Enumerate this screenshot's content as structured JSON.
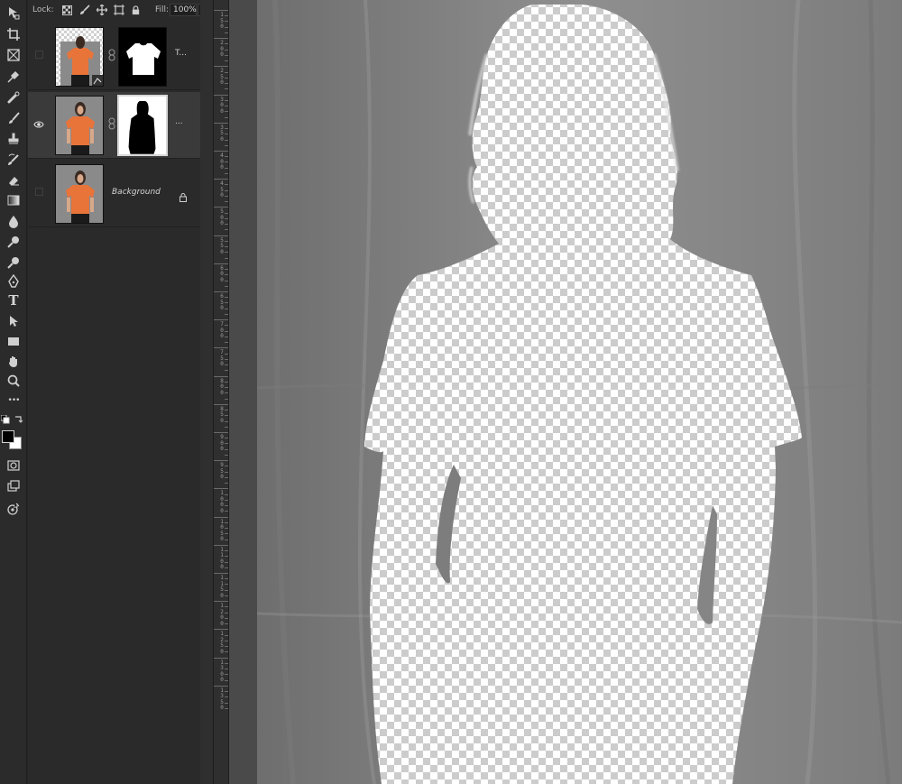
{
  "colors": {
    "panel_bg": "#2a2a2a",
    "selected_layer_bg": "#3a3a3a",
    "backdrop_gray": "#8a8a8a",
    "shirt_orange": "#e8743a",
    "pasteboard": "#4a4a4a"
  },
  "toolbar": {
    "tools": [
      {
        "name": "move-tool",
        "icon": "move-icon"
      },
      {
        "name": "crop-tool",
        "icon": "crop-icon"
      },
      {
        "name": "frame-tool",
        "icon": "frame-icon"
      },
      {
        "name": "eyedropper-tool",
        "icon": "eyedropper-icon"
      },
      {
        "name": "spot-healing-tool",
        "icon": "healing-brush-icon"
      },
      {
        "name": "brush-tool",
        "icon": "brush-icon"
      },
      {
        "name": "clone-stamp-tool",
        "icon": "stamp-icon"
      },
      {
        "name": "history-brush-tool",
        "icon": "history-brush-icon"
      },
      {
        "name": "eraser-tool",
        "icon": "eraser-icon"
      },
      {
        "name": "gradient-tool",
        "icon": "gradient-icon"
      },
      {
        "name": "blur-tool",
        "icon": "drop-icon"
      },
      {
        "name": "dodge-tool",
        "icon": "dodge-icon"
      },
      {
        "name": "pen-tool",
        "icon": "pen-icon"
      },
      {
        "name": "type-tool",
        "icon": "type-icon"
      },
      {
        "name": "path-selection-tool",
        "icon": "arrow-pointer-icon"
      },
      {
        "name": "rectangle-tool",
        "icon": "rectangle-icon"
      },
      {
        "name": "hand-tool",
        "icon": "hand-icon"
      },
      {
        "name": "zoom-tool",
        "icon": "magnifier-icon"
      },
      {
        "name": "edit-toolbar",
        "icon": "more-dots-icon"
      }
    ],
    "type_glyph": "T",
    "more_glyph": "•••"
  },
  "lockbar": {
    "lock_label": "Lock:",
    "fill_label": "Fill:",
    "fill_value": "100%"
  },
  "layers": [
    {
      "name": "T...",
      "visible": false,
      "has_mask": true,
      "mask": "shirt",
      "selected": false,
      "italic": false,
      "locked": false
    },
    {
      "name": "...",
      "visible": true,
      "has_mask": true,
      "mask": "person",
      "selected": true,
      "italic": false,
      "locked": false
    },
    {
      "name": "Background",
      "visible": false,
      "has_mask": false,
      "selected": false,
      "italic": true,
      "locked": true
    }
  ],
  "ruler": {
    "labels": [
      "1",
      "1",
      "2",
      "2",
      "3",
      "3",
      "4",
      "4",
      "5",
      "5",
      "6",
      "6",
      "7",
      "7",
      "8",
      "8",
      "9",
      "9",
      "1",
      "1",
      "1",
      "1",
      "1"
    ],
    "label_digits": [
      [
        "1",
        "5",
        "0"
      ],
      [
        "2",
        "0",
        "0"
      ],
      [
        "2",
        "5",
        "0"
      ],
      [
        "3",
        "0",
        "0"
      ],
      [
        "3",
        "5",
        "0"
      ],
      [
        "4",
        "0",
        "0"
      ],
      [
        "4",
        "5",
        "0"
      ],
      [
        "5",
        "0",
        "0"
      ],
      [
        "5",
        "5",
        "0"
      ],
      [
        "6",
        "0",
        "0"
      ],
      [
        "6",
        "5",
        "0"
      ],
      [
        "7",
        "0",
        "0"
      ],
      [
        "7",
        "5",
        "0"
      ],
      [
        "8",
        "0",
        "0"
      ],
      [
        "8",
        "5",
        "0"
      ],
      [
        "9",
        "0",
        "0"
      ],
      [
        "9",
        "5",
        "0"
      ],
      [
        "1",
        "0",
        "0",
        "0"
      ],
      [
        "1",
        "0",
        "5",
        "0"
      ],
      [
        "1",
        "1",
        "0",
        "0"
      ],
      [
        "1",
        "1",
        "5",
        "0"
      ],
      [
        "1",
        "2",
        "0",
        "0"
      ],
      [
        "1",
        "2",
        "5",
        "0"
      ],
      [
        "1",
        "3",
        "0",
        "0"
      ],
      [
        "1",
        "3",
        "5",
        "0"
      ]
    ]
  }
}
